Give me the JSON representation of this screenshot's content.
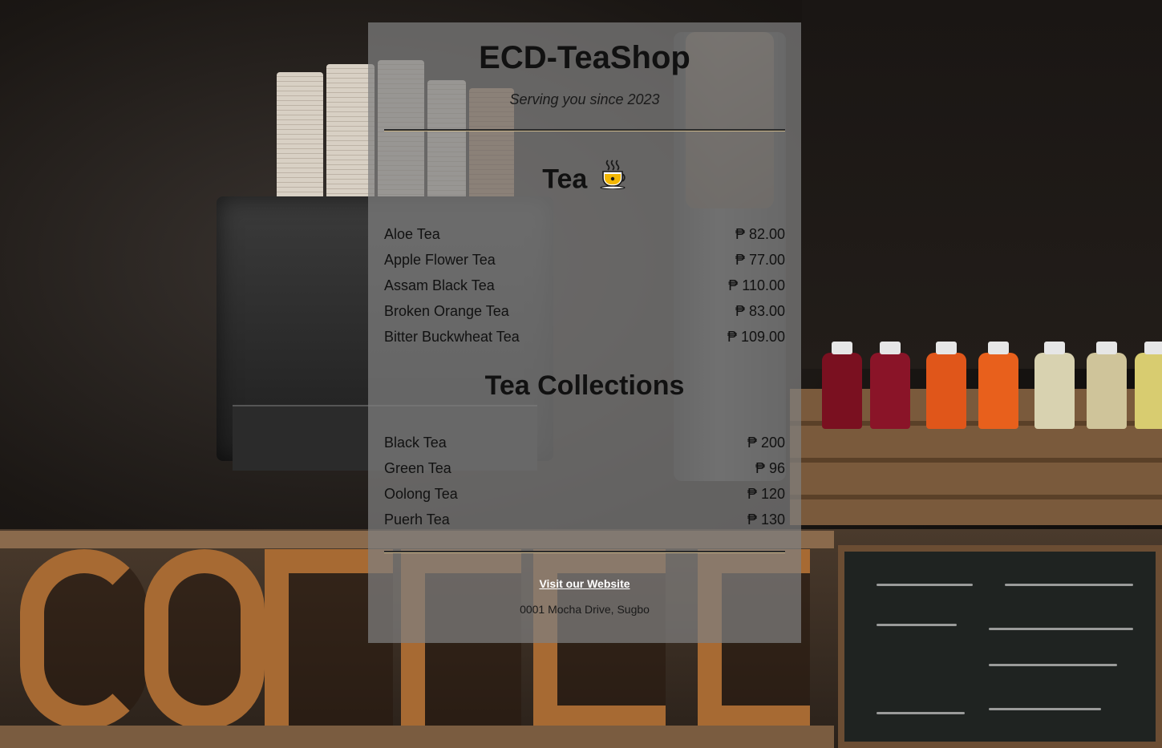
{
  "header": {
    "title": "ECD-TeaShop",
    "tagline": "Serving you since 2023"
  },
  "sections": [
    {
      "title": "Tea",
      "icon": "hot-tea-cup-icon",
      "items": [
        {
          "name": "Aloe Tea",
          "price": "₱ 82.00"
        },
        {
          "name": "Apple Flower Tea",
          "price": "₱ 77.00"
        },
        {
          "name": "Assam Black Tea",
          "price": "₱ 110.00"
        },
        {
          "name": "Broken Orange Tea",
          "price": "₱ 83.00"
        },
        {
          "name": "Bitter Buckwheat Tea",
          "price": "₱ 109.00"
        }
      ]
    },
    {
      "title": "Tea Collections",
      "items": [
        {
          "name": "Black Tea",
          "price": "₱ 200"
        },
        {
          "name": "Green Tea",
          "price": "₱ 96"
        },
        {
          "name": "Oolong Tea",
          "price": "₱ 120"
        },
        {
          "name": "Puerh Tea",
          "price": "₱ 130"
        }
      ]
    }
  ],
  "footer": {
    "link_label": "Visit our Website",
    "address": "0001 Mocha Drive, Sugbo"
  },
  "colors": {
    "card_background": "#808080",
    "accent_rule": "#c9b58a",
    "link": "#ffffff"
  }
}
